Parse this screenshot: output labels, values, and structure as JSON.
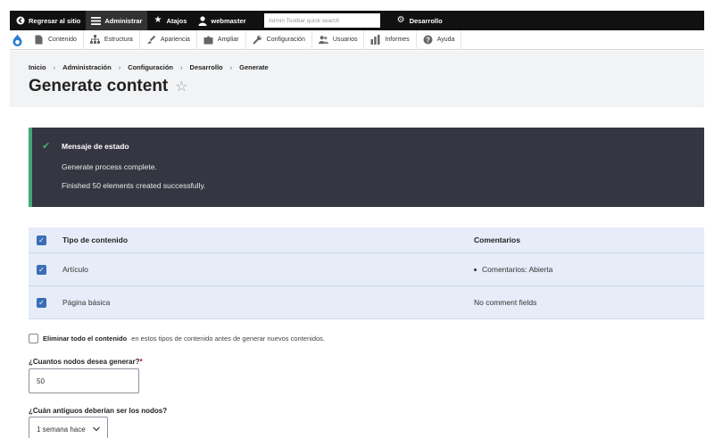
{
  "toolbar": {
    "back_label": "Regresar al sitio",
    "manage_label": "Administrar",
    "shortcuts_label": "Atajos",
    "user_label": "webmaster",
    "search_placeholder": "Admin Toolbar quick search",
    "devel_label": "Desarrollo"
  },
  "menu": {
    "items": [
      {
        "label": "Contenido",
        "icon": "document-icon"
      },
      {
        "label": "Estructura",
        "icon": "structure-icon"
      },
      {
        "label": "Apariencia",
        "icon": "brush-icon"
      },
      {
        "label": "Ampliar",
        "icon": "puzzle-icon"
      },
      {
        "label": "Configuración",
        "icon": "wrench-icon"
      },
      {
        "label": "Usuarios",
        "icon": "people-icon"
      },
      {
        "label": "Informes",
        "icon": "bar-chart-icon"
      },
      {
        "label": "Ayuda",
        "icon": "help-icon"
      }
    ]
  },
  "breadcrumb": [
    "Inicio",
    "Administración",
    "Configuración",
    "Desarrollo",
    "Generate"
  ],
  "page": {
    "title": "Generate content"
  },
  "status": {
    "title": "Mensaje de estado",
    "line1": "Generate process complete.",
    "line2": "Finished 50 elements created successfully."
  },
  "table": {
    "headers": {
      "type": "Tipo de contenido",
      "comments": "Comentarios"
    },
    "rows": [
      {
        "type": "Artículo",
        "comments": "Comentarios: Abierta"
      },
      {
        "type": "Página básica",
        "comments": "No comment fields"
      }
    ]
  },
  "form": {
    "delete_bold": "Eliminar todo el contenido",
    "delete_rest": "en estos tipos de contenido antes de generar nuevos contenidos.",
    "nodes_label": "¿Cuantos nodos desea generar?",
    "nodes_value": "50",
    "age_label": "¿Cuán antiguos deberían ser los nodos?",
    "age_value": "1 semana hace"
  },
  "colors": {
    "toolbar_bg": "#111111",
    "status_bg": "#353641",
    "status_accent": "#42a877",
    "checkbox_blue": "#3a6db5",
    "table_row_bg": "#e6ecf8"
  }
}
